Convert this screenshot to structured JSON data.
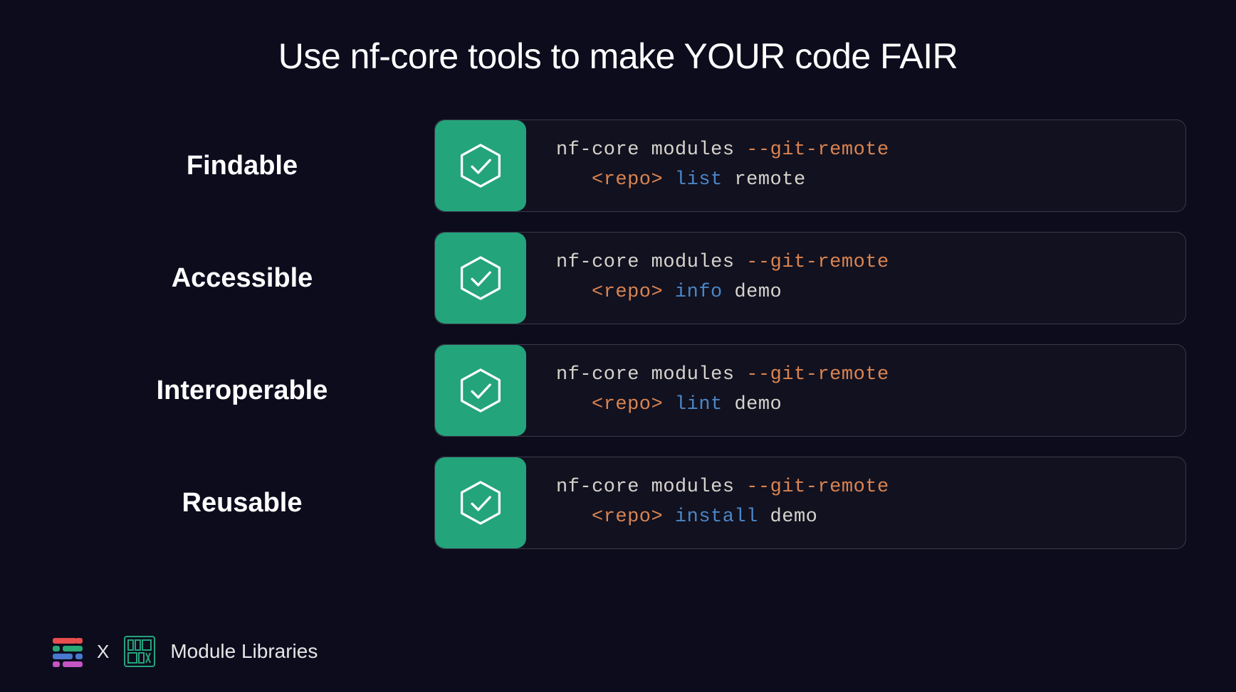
{
  "title": "Use nf-core tools to make YOUR code FAIR",
  "rows": [
    {
      "label": "Findable",
      "cmd": "nf-core modules",
      "flag": "--git-remote",
      "angle": "<repo>",
      "sub": "list",
      "arg": "remote"
    },
    {
      "label": "Accessible",
      "cmd": "nf-core modules",
      "flag": "--git-remote",
      "angle": "<repo>",
      "sub": "info",
      "arg": "demo"
    },
    {
      "label": "Interoperable",
      "cmd": "nf-core modules",
      "flag": "--git-remote",
      "angle": "<repo>",
      "sub": "lint",
      "arg": "demo"
    },
    {
      "label": "Reusable",
      "cmd": "nf-core modules",
      "flag": "--git-remote",
      "angle": "<repo>",
      "sub": "install",
      "arg": "demo"
    }
  ],
  "footer": {
    "x": "X",
    "label": "Module Libraries"
  },
  "icon_name": "hexagon-check-icon"
}
